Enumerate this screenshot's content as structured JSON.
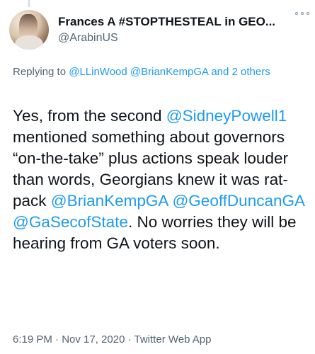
{
  "author": {
    "display_name": "Frances A #STOPTHESTEAL in GEO...",
    "handle": "@ArabinUS"
  },
  "reply": {
    "prefix": "Replying to ",
    "mention1": "@LLinWood",
    "space": " ",
    "mention2": "@BrianKempGA",
    "suffix": " and 2 others"
  },
  "tweet": {
    "t1": "Yes, from the second ",
    "m1": "@SidneyPowell1",
    "t2": " mentioned something about governors “on-the-take” plus actions speak louder than words, Georgians knew it was rat-pack ",
    "m2": "@BrianKempGA",
    "t3": " ",
    "m3": "@GeoffDuncanGA",
    "t4": " ",
    "m4": "@GaSecofState",
    "t5": ". No worries they will be hearing from GA voters soon."
  },
  "meta": {
    "time": "6:19 PM",
    "sep1": " · ",
    "date": "Nov 17, 2020",
    "sep2": " · ",
    "source": "Twitter Web App"
  },
  "colors": {
    "link": "#1d9bf0",
    "text": "#0f1419",
    "secondary": "#536471"
  }
}
